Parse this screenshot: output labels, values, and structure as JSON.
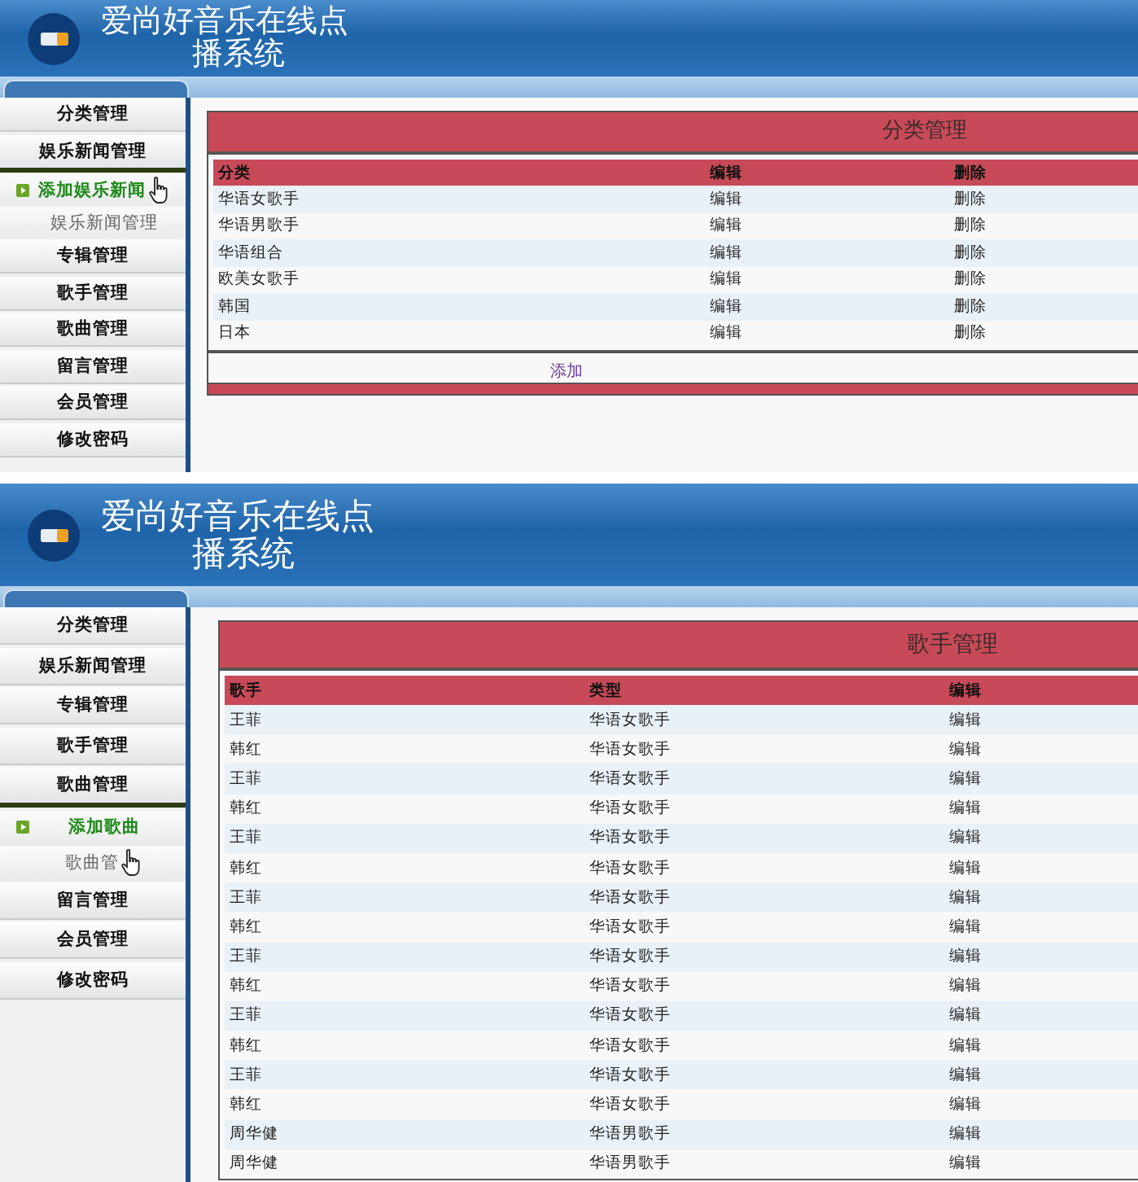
{
  "screens": [
    {
      "header": {
        "title_lines": [
          "爱尚好音乐在线点",
          "播系统"
        ]
      },
      "sidebar": {
        "items": [
          {
            "label": "分类管理",
            "expanded": false
          },
          {
            "label": "娱乐新闻管理",
            "expanded": true,
            "children": [
              {
                "label": "添加娱乐新闻",
                "selected": true,
                "hovered": true
              },
              {
                "label": "娱乐新闻管理",
                "selected": false,
                "hovered": false
              }
            ]
          },
          {
            "label": "专辑管理",
            "expanded": false
          },
          {
            "label": "歌手管理",
            "expanded": false
          },
          {
            "label": "歌曲管理",
            "expanded": false
          },
          {
            "label": "留言管理",
            "expanded": false
          },
          {
            "label": "会员管理",
            "expanded": false
          },
          {
            "label": "修改密码",
            "expanded": false
          }
        ]
      },
      "panel": {
        "title": "分类管理",
        "columns": [
          "分类",
          "编辑",
          "删除"
        ],
        "rows": [
          [
            "华语女歌手",
            "编辑",
            "删除"
          ],
          [
            "华语男歌手",
            "编辑",
            "删除"
          ],
          [
            "华语组合",
            "编辑",
            "删除"
          ],
          [
            "欧美女歌手",
            "编辑",
            "删除"
          ],
          [
            "韩国",
            "编辑",
            "删除"
          ],
          [
            "日本",
            "编辑",
            "删除"
          ]
        ],
        "footer_link": "添加"
      }
    },
    {
      "header": {
        "title_lines": [
          "爱尚好音乐在线点",
          "播系统"
        ]
      },
      "sidebar": {
        "items": [
          {
            "label": "分类管理",
            "expanded": false
          },
          {
            "label": "娱乐新闻管理",
            "expanded": false
          },
          {
            "label": "专辑管理",
            "expanded": false
          },
          {
            "label": "歌手管理",
            "expanded": false
          },
          {
            "label": "歌曲管理",
            "expanded": true,
            "children": [
              {
                "label": "添加歌曲",
                "selected": true,
                "hovered": false
              },
              {
                "label": "歌曲管",
                "selected": false,
                "hovered": true
              }
            ]
          },
          {
            "label": "留言管理",
            "expanded": false
          },
          {
            "label": "会员管理",
            "expanded": false
          },
          {
            "label": "修改密码",
            "expanded": false
          }
        ]
      },
      "panel": {
        "title": "歌手管理",
        "columns": [
          "歌手",
          "类型",
          "编辑"
        ],
        "rows": [
          [
            "王菲",
            "华语女歌手",
            "编辑"
          ],
          [
            "韩红",
            "华语女歌手",
            "编辑"
          ],
          [
            "王菲",
            "华语女歌手",
            "编辑"
          ],
          [
            "韩红",
            "华语女歌手",
            "编辑"
          ],
          [
            "王菲",
            "华语女歌手",
            "编辑"
          ],
          [
            "韩红",
            "华语女歌手",
            "编辑"
          ],
          [
            "王菲",
            "华语女歌手",
            "编辑"
          ],
          [
            "韩红",
            "华语女歌手",
            "编辑"
          ],
          [
            "王菲",
            "华语女歌手",
            "编辑"
          ],
          [
            "韩红",
            "华语女歌手",
            "编辑"
          ],
          [
            "王菲",
            "华语女歌手",
            "编辑"
          ],
          [
            "韩红",
            "华语女歌手",
            "编辑"
          ],
          [
            "王菲",
            "华语女歌手",
            "编辑"
          ],
          [
            "韩红",
            "华语女歌手",
            "编辑"
          ],
          [
            "周华健",
            "华语男歌手",
            "编辑"
          ],
          [
            "周华健",
            "华语男歌手",
            "编辑"
          ]
        ]
      }
    }
  ]
}
